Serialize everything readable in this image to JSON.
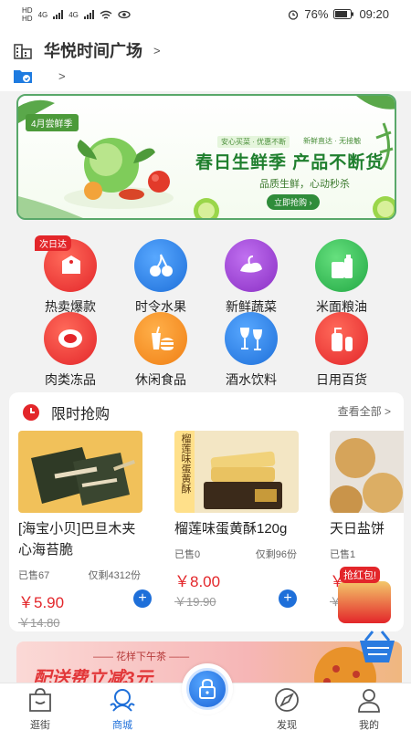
{
  "status": {
    "carrier_tags": [
      "HD",
      "HD"
    ],
    "net": [
      "4G",
      "4G"
    ],
    "battery": "76%",
    "time": "09:20"
  },
  "header": {
    "store_name": "华悦时间广场",
    "chevron": ">",
    "sub_chevron": ">"
  },
  "banner": {
    "tag": "4月尝鲜季",
    "chip_left": "安心买菜 · 优惠不断",
    "chip_right": "新鲜直达 · 无接触",
    "headline": "春日生鲜季 产品不断货",
    "subline": "品质生鲜，心动秒杀",
    "button": "立即抢购 ›",
    "colors": {
      "border": "#59a86a",
      "headline": "#1f7f2e"
    }
  },
  "categories": [
    {
      "label": "热卖爆款",
      "badge": "次日达",
      "icon": "price-tag-icon",
      "color": "#e3262a"
    },
    {
      "label": "时令水果",
      "icon": "cherry-icon",
      "color": "#1e7be0"
    },
    {
      "label": "新鲜蔬菜",
      "icon": "vegetable-icon",
      "color": "#9b3fd1"
    },
    {
      "label": "米面粮油",
      "icon": "oil-bottle-icon",
      "color": "#2bb24c"
    },
    {
      "label": "肉类冻品",
      "icon": "meat-icon",
      "color": "#e3262a"
    },
    {
      "label": "休闲食品",
      "icon": "snack-icon",
      "color": "#f07f14"
    },
    {
      "label": "酒水饮料",
      "icon": "wine-glass-icon",
      "color": "#1e7be0"
    },
    {
      "label": "日用百货",
      "icon": "lotion-icon",
      "color": "#e3262a"
    }
  ],
  "flash_sale": {
    "title": "限时抢购",
    "more": "查看全部 >",
    "products": [
      {
        "name": "[海宝小贝]巴旦木夹心海苔脆",
        "sold": "已售67",
        "left": "仅剩4312份",
        "price": "￥5.90",
        "old_price": "￥14.80",
        "image_text": ""
      },
      {
        "name": "榴莲味蛋黄酥120g",
        "sold": "已售0",
        "left": "仅剩96份",
        "price": "￥8.00",
        "old_price": "￥19.90",
        "image_text": "榴莲味蛋黄酥"
      },
      {
        "name": "天日盐饼",
        "sold": "已售1",
        "left": "",
        "price": "￥",
        "old_price": "￥",
        "image_text": ""
      }
    ]
  },
  "red_packet": {
    "label": "抢红包!"
  },
  "promo": {
    "line1": "—— 花样下午茶 ——",
    "line2": "配送费立减3元"
  },
  "tabs": [
    {
      "label": "逛街",
      "icon": "bag-icon"
    },
    {
      "label": "商城",
      "icon": "mall-icon",
      "active": true
    },
    {
      "label": "",
      "icon": "lock-icon"
    },
    {
      "label": "发现",
      "icon": "discover-icon"
    },
    {
      "label": "我的",
      "icon": "user-icon"
    }
  ]
}
